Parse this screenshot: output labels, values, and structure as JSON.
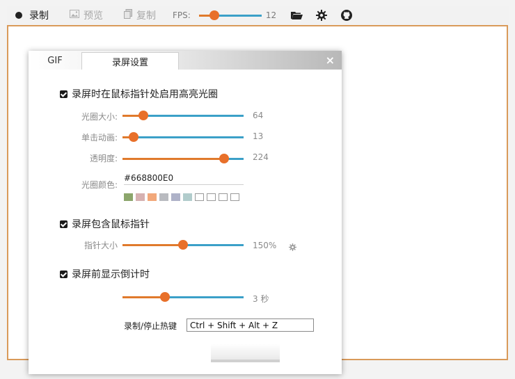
{
  "toolbar": {
    "record_label": "录制",
    "preview_label": "预览",
    "copy_label": "复制",
    "fps_label": "FPS:",
    "fps_value": "12",
    "fps_fraction": 0.25,
    "icons": [
      "record-dot",
      "image-icon",
      "copy-icon",
      "folder-open-icon",
      "gear-icon",
      "github-icon"
    ]
  },
  "dialog": {
    "tabs": [
      "GIF",
      "录屏设置"
    ],
    "close_label": "×",
    "highlight": {
      "checked": true,
      "label": "录屏时在鼠标指针处启用高亮光圈",
      "size": {
        "label": "光圈大小:",
        "value": "64",
        "fraction": 0.17
      },
      "animation": {
        "label": "单击动画:",
        "value": "13",
        "fraction": 0.09
      },
      "opacity": {
        "label": "透明度:",
        "value": "224",
        "fraction": 0.84
      },
      "color": {
        "label": "光圈颜色:",
        "value": "#668800E0"
      },
      "swatches": [
        "#8ca66c",
        "#d6b1b1",
        "#f2a87a",
        "#b9bbc0",
        "#aeb2c8",
        "#b1cccc",
        "#ffffff",
        "#ffffff",
        "#ffffff",
        "#ffffff"
      ]
    },
    "include_cursor": {
      "checked": true,
      "label": "录屏包含鼠标指针",
      "pointer_size": {
        "label": "指针大小",
        "value": "150%",
        "fraction": 0.5
      }
    },
    "countdown": {
      "checked": true,
      "label": "录屏前显示倒计时",
      "value": "3 秒",
      "fraction": 0.35
    },
    "hotkey": {
      "label": "录制/停止热键",
      "value": "Ctrl + Shift + Alt + Z"
    },
    "colors": {
      "slider_left": "#e07a2c",
      "slider_right": "#3ba0c8",
      "thumb": "#e8702a",
      "capture_border": "#d99a5a"
    }
  }
}
